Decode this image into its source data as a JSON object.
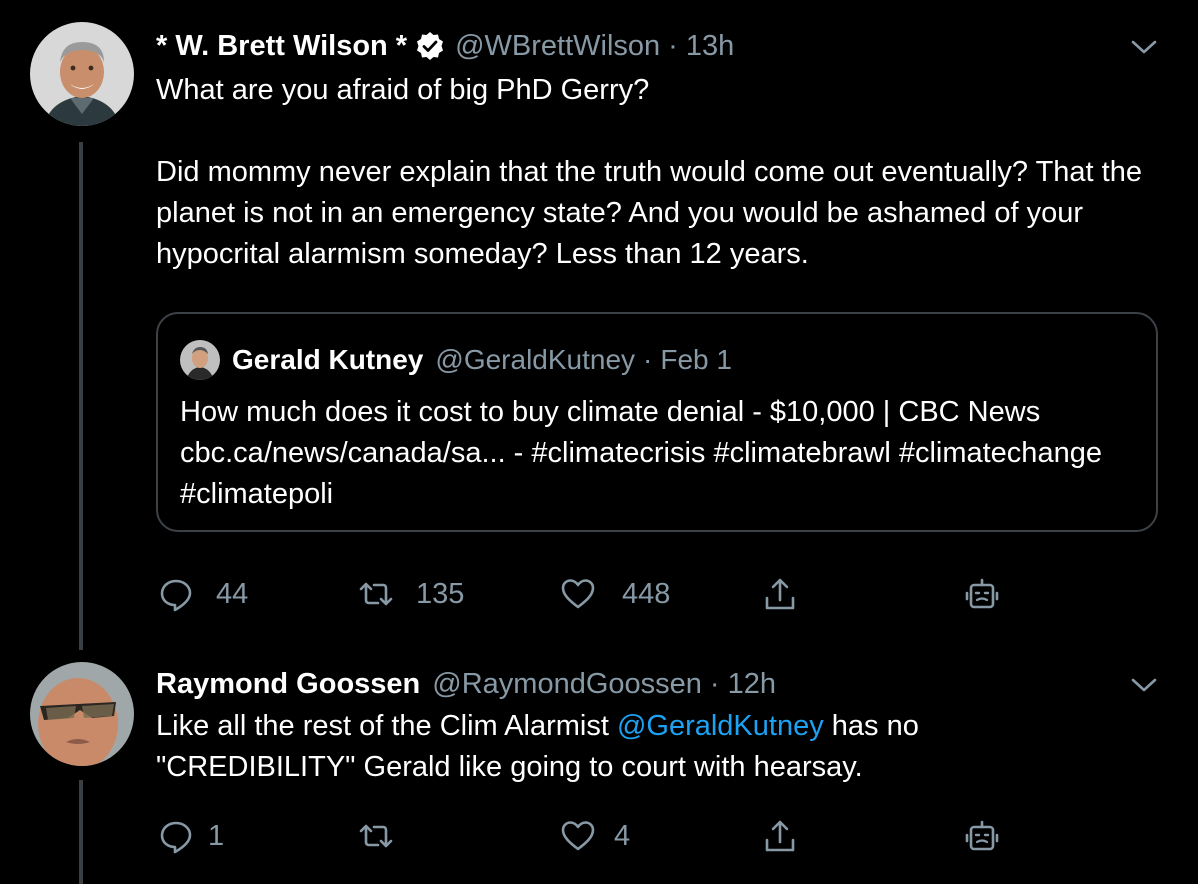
{
  "tweet1": {
    "display_name": "* W. Brett Wilson *",
    "verified_icon": "verified-badge-icon",
    "handle": "@WBrettWilson",
    "separator": "·",
    "time": "13h",
    "text": "What are you afraid of big PhD Gerry?\n\nDid mommy never explain that the truth would come out eventually? That the planet is not in an emergency state? And you would be ashamed of your hypocrital alarmism someday? Less than 12 years.",
    "quote": {
      "display_name": "Gerald Kutney",
      "handle": "@GeraldKutney",
      "separator": "·",
      "date": "Feb 1",
      "text": "How much does it cost to buy climate denial -  $10,000 | CBC News cbc.ca/news/canada/sa... - #climatecrisis #climatebrawl #climatechange #climatepoli"
    },
    "actions": {
      "replies": "44",
      "retweets": "135",
      "likes": "448"
    }
  },
  "tweet2": {
    "display_name": "Raymond Goossen",
    "handle": "@RaymondGoossen",
    "separator": "·",
    "time": "12h",
    "text_before": "Like all the rest of the Clim Alarmist ",
    "mention": "@GeraldKutney",
    "text_after": " has no \"CREDIBILITY\"  Gerald like going to court with hearsay.",
    "actions": {
      "replies": "1",
      "retweets": "",
      "likes": "4"
    }
  },
  "colors": {
    "background": "#000000",
    "text": "#ffffff",
    "secondary": "#8899a6",
    "link": "#1da1f2",
    "border": "#3d4247"
  }
}
